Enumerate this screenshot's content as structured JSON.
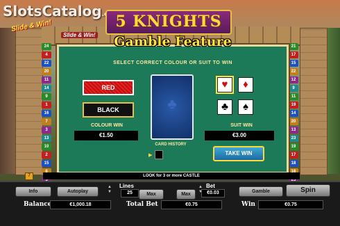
{
  "watermark": {
    "brand": "SlotsCatalog",
    "suffix": ".com",
    "badge": "Slide & Win!"
  },
  "game": {
    "logo": "5 KNIGHTS",
    "small_logo": "Slide & Win!"
  },
  "gamble": {
    "title": "Gamble Feature",
    "instruction": "SELECT CORRECT COLOUR OR SUIT TO WIN",
    "red_label": "RED",
    "black_label": "BLACK",
    "colour_win_label": "COLOUR WIN",
    "colour_win_value": "€1.50",
    "card_history_label": "CARD HISTORY",
    "suit_win_label": "SUIT WIN",
    "suit_win_value": "€3.00",
    "take_win_label": "TAKE WIN",
    "suits": [
      {
        "symbol": "♥",
        "name": "hearts",
        "color": "#d01010"
      },
      {
        "symbol": "♦",
        "name": "diamonds",
        "color": "#d01010"
      },
      {
        "symbol": "♣",
        "name": "clubs",
        "color": "#000000"
      },
      {
        "symbol": "♠",
        "name": "spades",
        "color": "#000000"
      }
    ]
  },
  "paylines_left": [
    "24",
    "4",
    "22",
    "20",
    "11",
    "14",
    "9",
    "1",
    "16",
    "7",
    "3",
    "13",
    "10",
    "2",
    "15",
    "6",
    "5"
  ],
  "paylines_right": [
    "21",
    "17",
    "15",
    "22",
    "12",
    "9",
    "11",
    "19",
    "14",
    "20",
    "13",
    "23",
    "19",
    "17",
    "18",
    "16",
    "25"
  ],
  "ticker": {
    "text": "LOOK for 3 or more CASTLE",
    "icon": "7"
  },
  "controls": {
    "info": "Info",
    "autoplay": "Autoplay",
    "lines_label": "Lines",
    "lines_value": "25",
    "max_lines": "Max",
    "max_bet": "Max",
    "bet_label": "Bet",
    "bet_value": "€0.03",
    "gamble": "Gamble",
    "spin": "Spin",
    "balance_label": "Balance",
    "balance_value": "€1,000.18",
    "total_bet_label": "Total Bet",
    "total_bet_value": "€0.75",
    "win_label": "Win",
    "win_value": "€0.75"
  }
}
